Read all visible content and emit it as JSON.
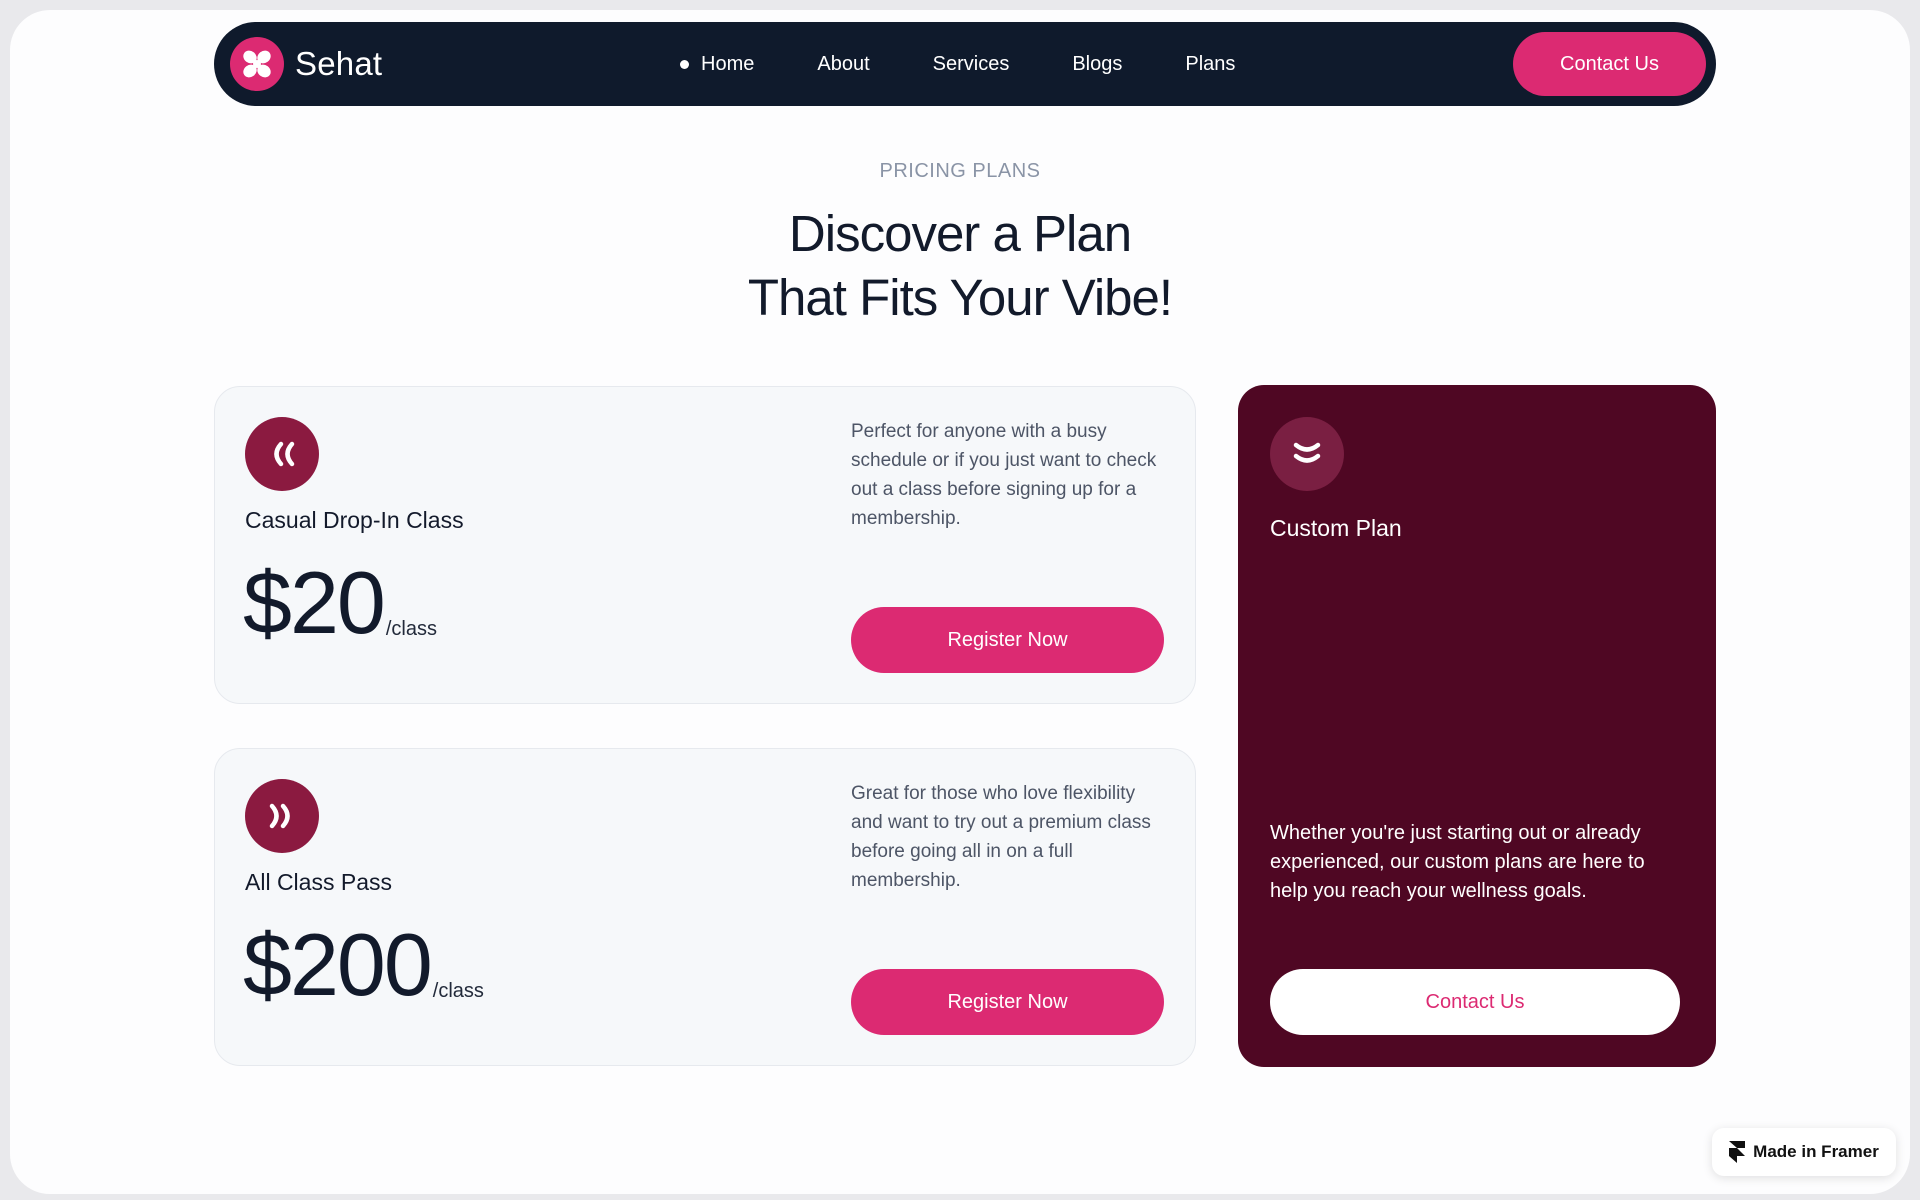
{
  "brand": {
    "name": "Sehat",
    "accent": "#dc2a72",
    "nav_bg": "#0f1a2c",
    "custom_bg": "#4f0723"
  },
  "nav": {
    "items": [
      {
        "label": "Home",
        "active": true
      },
      {
        "label": "About"
      },
      {
        "label": "Services"
      },
      {
        "label": "Blogs"
      },
      {
        "label": "Plans"
      }
    ],
    "cta": "Contact Us"
  },
  "section": {
    "eyebrow": "PRICING PLANS",
    "headline_line1": "Discover a Plan",
    "headline_line2": "That Fits Your Vibe!"
  },
  "plans": [
    {
      "icon": "chevrons-left-icon",
      "title": "Casual Drop-In Class",
      "price": "$20",
      "unit": "/class",
      "description": "Perfect for anyone with a busy schedule or if you just want to check out a class before signing up for a membership.",
      "button": "Register Now"
    },
    {
      "icon": "chevrons-right-icon",
      "title": "All Class Pass",
      "price": "$200",
      "unit": "/class",
      "description": "Great for those who love flexibility and want to try out a premium class before going all in on a full membership.",
      "button": "Register Now"
    }
  ],
  "custom_plan": {
    "icon": "chevrons-down-icon",
    "title": "Custom Plan",
    "description": "Whether you're just starting out or already experienced, our custom plans are here to help you reach your wellness goals.",
    "button": "Contact Us"
  },
  "badge": {
    "label": "Made in Framer",
    "icon": "framer-icon"
  }
}
